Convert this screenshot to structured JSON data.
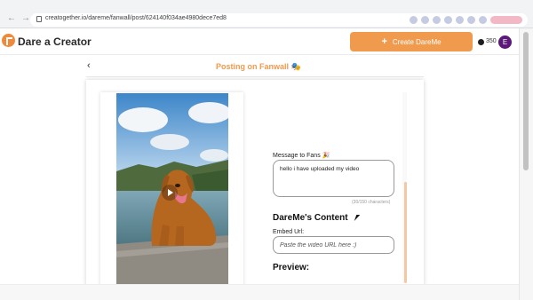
{
  "browser": {
    "url": "creatogether.io/dareme/fanwall/post/624140f034ae4980dece7ed8"
  },
  "app": {
    "brand": "Dare a Creator",
    "create_button": "Create DareMe",
    "coins": "350",
    "avatar_initial": "E",
    "accent_color": "#ef9a4d"
  },
  "page": {
    "back_icon": "‹",
    "title": "Posting on Fanwall 🎭"
  },
  "form": {
    "message_label": "Message to Fans 🎉",
    "message_value": "hello i have uploaded my video",
    "char_counter": "(30/150 characters)",
    "content_heading": "DareMe's Content",
    "embed_label": "Embed Url:",
    "embed_placeholder": "Paste the video URL here :)",
    "preview_heading": "Preview:"
  },
  "icons": {
    "logo": "dare-logo-icon",
    "play": "play-icon",
    "back": "chevron-left-icon",
    "coin": "coin-icon",
    "lock": "lock-icon"
  }
}
